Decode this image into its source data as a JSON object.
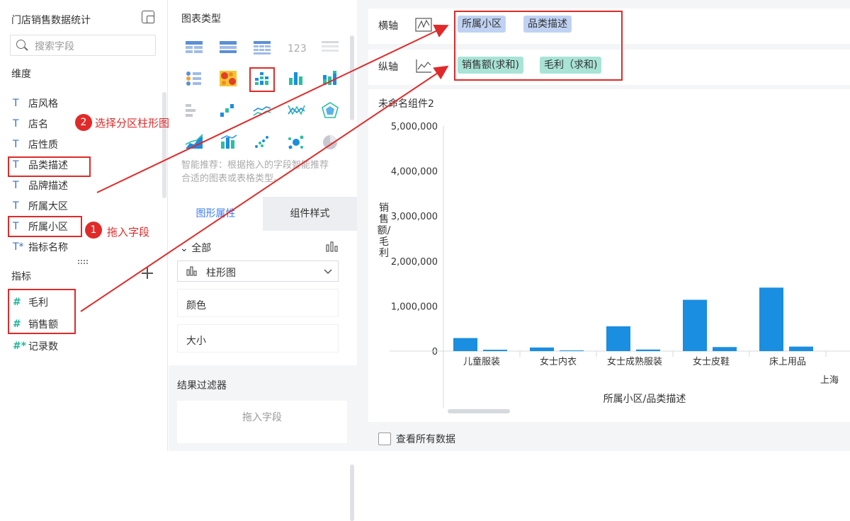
{
  "left_panel": {
    "dataset_title": "门店销售数据统计",
    "search_placeholder": "搜索字段",
    "dimension_label": "维度",
    "dimensions": [
      "店风格",
      "店名",
      "店性质",
      "品类描述",
      "品牌描述",
      "所属大区",
      "所属小区",
      "指标名称"
    ],
    "measure_label": "指标",
    "measures": [
      "毛利",
      "销售额",
      "记录数"
    ]
  },
  "chart_type_panel": {
    "title": "图表类型",
    "selected_icon": "grouped-bar-chart-icon",
    "hint": "智能推荐：根据拖入的字段智能推荐合适的图表或表格类型。"
  },
  "property_tabs": [
    "图形属性",
    "组件样式"
  ],
  "property_panel": {
    "all_label": "全部",
    "chart_kind": "柱形图",
    "items": [
      "颜色",
      "大小"
    ]
  },
  "filter_panel": {
    "title": "结果过滤器",
    "drop_hint": "拖入字段"
  },
  "axes": {
    "x_label": "横轴",
    "x_pills": [
      "所属小区",
      "品类描述"
    ],
    "y_label": "纵轴",
    "y_pills": [
      "销售额(求和)",
      "毛利（求和)"
    ]
  },
  "chart_card": {
    "title": "未命名组件2",
    "ylabel": "销售额/毛利",
    "xlabel": "所属小区/品类描述",
    "group_label": "上海",
    "show_all_label": "查看所有数据"
  },
  "annotations": {
    "step1_number": "1",
    "step1_text": "拖入字段",
    "step2_number": "2",
    "step2_text": "选择分区柱形图"
  },
  "colors": {
    "bar": "#1a8ee0",
    "accent": "#3d7cf2",
    "red": "#e02a2a",
    "x_pill": "#bfd2f3",
    "y_pill": "#a8e3d6"
  },
  "chart_data": {
    "type": "bar",
    "categories": [
      "儿童服装",
      "女士内衣",
      "女士成熟服装",
      "女士皮鞋",
      "床上用品"
    ],
    "series": [
      {
        "values": [
          290000,
          80000,
          550000,
          1140000,
          1410000
        ]
      },
      {
        "values": [
          30000,
          15000,
          35000,
          90000,
          100000
        ]
      }
    ],
    "ylim": [
      0,
      5000000
    ],
    "yticks": [
      "0",
      "1,000,000",
      "2,000,000",
      "3,000,000",
      "4,000,000",
      "5,000,000"
    ],
    "xlabel": "所属小区/品类描述",
    "ylabel": "销售额/毛利",
    "grid": false
  }
}
